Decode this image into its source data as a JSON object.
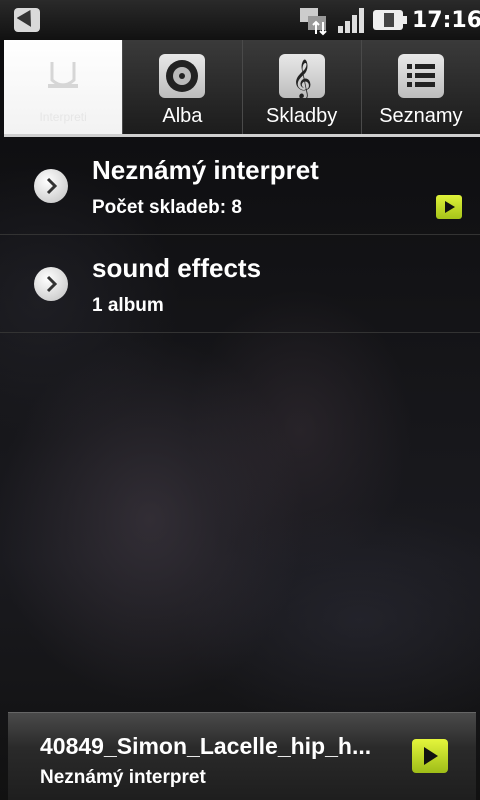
{
  "status_bar": {
    "time": "17:16",
    "icons": [
      "notification-arrow-icon",
      "data-transfer-icon",
      "signal-icon",
      "battery-icon"
    ]
  },
  "tabs": [
    {
      "label": "Interpreti",
      "icon": "artist-icon",
      "selected": true
    },
    {
      "label": "Alba",
      "icon": "album-disc-icon",
      "selected": false
    },
    {
      "label": "Skladby",
      "icon": "treble-clef-icon",
      "selected": false
    },
    {
      "label": "Seznamy",
      "icon": "playlist-icon",
      "selected": false
    }
  ],
  "artists": [
    {
      "name": "Neznámý interpret",
      "detail": "Počet skladeb: 8",
      "playing": true
    },
    {
      "name": "sound effects",
      "detail": "1 album",
      "playing": false
    }
  ],
  "now_playing": {
    "title": "40849_Simon_Lacelle_hip_h...",
    "artist": "Neznámý interpret"
  },
  "colors": {
    "accent_play": "#c8e02a",
    "background": "#000000"
  }
}
